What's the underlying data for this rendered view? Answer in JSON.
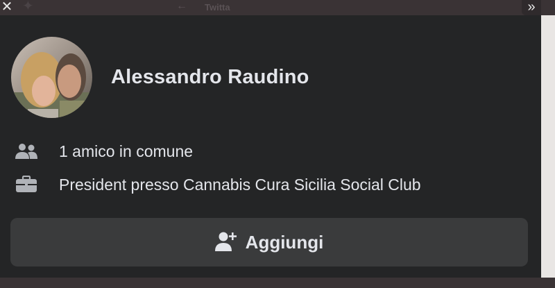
{
  "topbar": {
    "app_name": "Twitta",
    "bird_icon": "twitter-bird-icon",
    "back_icon": "back-arrow-icon",
    "close_icon": "close-icon",
    "expand_icon": "double-chevron-right-icon"
  },
  "profile": {
    "name": "Alessandro Raudino",
    "avatar_icon": "profile-photo"
  },
  "info": {
    "mutual_friends": "1 amico in comune",
    "mutual_icon": "friends-icon",
    "work": "President presso Cannabis Cura Sicilia Social Club",
    "work_icon": "briefcase-icon"
  },
  "actions": {
    "add_label": "Aggiungi",
    "add_icon": "add-friend-icon"
  },
  "colors": {
    "card_bg": "#242526",
    "button_bg": "#3a3b3c",
    "text": "#e4e6eb",
    "icon": "#b0b3b8"
  }
}
